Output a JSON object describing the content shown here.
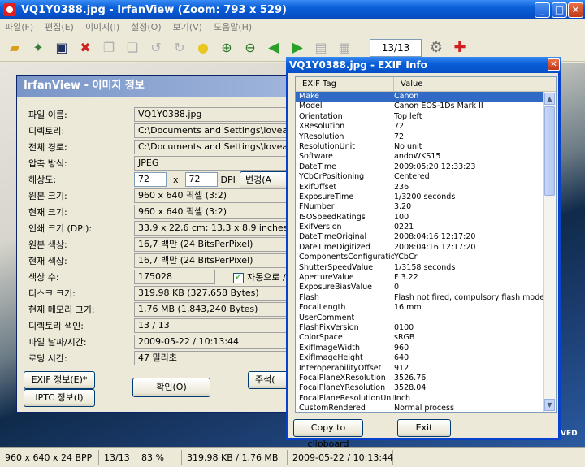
{
  "main_window": {
    "title": "VQ1Y0388.jpg - IrfanView (Zoom: 793 x 529)",
    "menu": [
      "파일(F)",
      "편집(E)",
      "이미지(I)",
      "설정(O)",
      "보기(V)",
      "도움말(H)"
    ],
    "page_counter": "13/13"
  },
  "status": {
    "dimensions": "960 x 640 x 24 BPP",
    "page": "13/13",
    "zoom": "83 %",
    "size": "319,98 KB / 1,76 MB",
    "date": "2009-05-22 / 10:13:44"
  },
  "info_dialog": {
    "title": "IrfanView - 이미지 정보",
    "rows": [
      {
        "label": "파일 이름:",
        "value": "VQ1Y0388.jpg"
      },
      {
        "label": "디렉토리:",
        "value": "C:\\Documents and Settings\\loveas"
      },
      {
        "label": "전체 경로:",
        "value": "C:\\Documents and Settings\\loveas"
      },
      {
        "label": "압축 방식:",
        "value": "JPEG"
      },
      {
        "label": "해상도:",
        "value": ""
      },
      {
        "label": "원본 크기:",
        "value": "960 x 640 픽셀 (3:2)"
      },
      {
        "label": "현재 크기:",
        "value": "960 x 640 픽셀 (3:2)"
      },
      {
        "label": "인쇄 크기 (DPI):",
        "value": "33,9 x 22,6 cm; 13,3 x 8,9 inches"
      },
      {
        "label": "원본 색상:",
        "value": "16,7 백만  (24 BitsPerPixel)"
      },
      {
        "label": "현재 색상:",
        "value": "16,7 백만  (24 BitsPerPixel)"
      },
      {
        "label": "색상 수:",
        "value": "175028"
      },
      {
        "label": "디스크 크기:",
        "value": "319,98 KB (327,658 Bytes)"
      },
      {
        "label": "현재 메모리 크기:",
        "value": "1,76  MB (1,843,240 Bytes)"
      },
      {
        "label": "디렉토리 색인:",
        "value": "13  /  13"
      },
      {
        "label": "파일 날짜/시간:",
        "value": "2009-05-22 / 10:13:44"
      },
      {
        "label": "로딩 시간:",
        "value": "47 밀리초"
      }
    ],
    "dpi_x": "72",
    "dpi_y": "72",
    "dpi_x_sep": "x",
    "dpi_unit": "DPI",
    "change_button": "변경(A",
    "auto_checkbox": "자동으로 /",
    "exif_button": "EXIF 정보(E)*",
    "iptc_button": "IPTC 정보(I)",
    "ok_button": "확인(O)",
    "comment_button": "주석("
  },
  "exif_dialog": {
    "title": "VQ1Y0388.jpg - EXIF Info",
    "col_tag": "EXIF Tag",
    "col_value": "Value",
    "rows": [
      {
        "tag": "Make",
        "value": "Canon"
      },
      {
        "tag": "Model",
        "value": "Canon EOS-1Ds Mark II"
      },
      {
        "tag": "Orientation",
        "value": "Top left"
      },
      {
        "tag": "XResolution",
        "value": "72"
      },
      {
        "tag": "YResolution",
        "value": "72"
      },
      {
        "tag": "ResolutionUnit",
        "value": "No unit"
      },
      {
        "tag": "Software",
        "value": "andoWKS15"
      },
      {
        "tag": "DateTime",
        "value": "2009:05:20 12:33:23"
      },
      {
        "tag": "YCbCrPositioning",
        "value": "Centered"
      },
      {
        "tag": "ExifOffset",
        "value": "236"
      },
      {
        "tag": "ExposureTime",
        "value": "1/3200 seconds"
      },
      {
        "tag": "FNumber",
        "value": "3.20"
      },
      {
        "tag": "ISOSpeedRatings",
        "value": "100"
      },
      {
        "tag": "ExifVersion",
        "value": "0221"
      },
      {
        "tag": "DateTimeOriginal",
        "value": "2008:04:16 12:17:20"
      },
      {
        "tag": "DateTimeDigitized",
        "value": "2008:04:16 12:17:20"
      },
      {
        "tag": "ComponentsConfiguration",
        "value": "YCbCr"
      },
      {
        "tag": "ShutterSpeedValue",
        "value": "1/3158 seconds"
      },
      {
        "tag": "ApertureValue",
        "value": "F 3.22"
      },
      {
        "tag": "ExposureBiasValue",
        "value": "0"
      },
      {
        "tag": "Flash",
        "value": "Flash not fired, compulsory flash mode"
      },
      {
        "tag": "FocalLength",
        "value": "16 mm"
      },
      {
        "tag": "UserComment",
        "value": ""
      },
      {
        "tag": "FlashPixVersion",
        "value": "0100"
      },
      {
        "tag": "ColorSpace",
        "value": "sRGB"
      },
      {
        "tag": "ExifImageWidth",
        "value": "960"
      },
      {
        "tag": "ExifImageHeight",
        "value": "640"
      },
      {
        "tag": "InteroperabilityOffset",
        "value": "912"
      },
      {
        "tag": "FocalPlaneXResolution",
        "value": "3526.76"
      },
      {
        "tag": "FocalPlaneYResolution",
        "value": "3528.04"
      },
      {
        "tag": "FocalPlaneResolutionUnit",
        "value": "Inch"
      },
      {
        "tag": "CustomRendered",
        "value": "Normal process"
      }
    ],
    "copy_button": "Copy to clipboard",
    "exit_button": "Exit"
  },
  "colors": {
    "selection": "#316ac5",
    "titlebar": "#0a5fd8"
  },
  "image_watermark": "VED"
}
